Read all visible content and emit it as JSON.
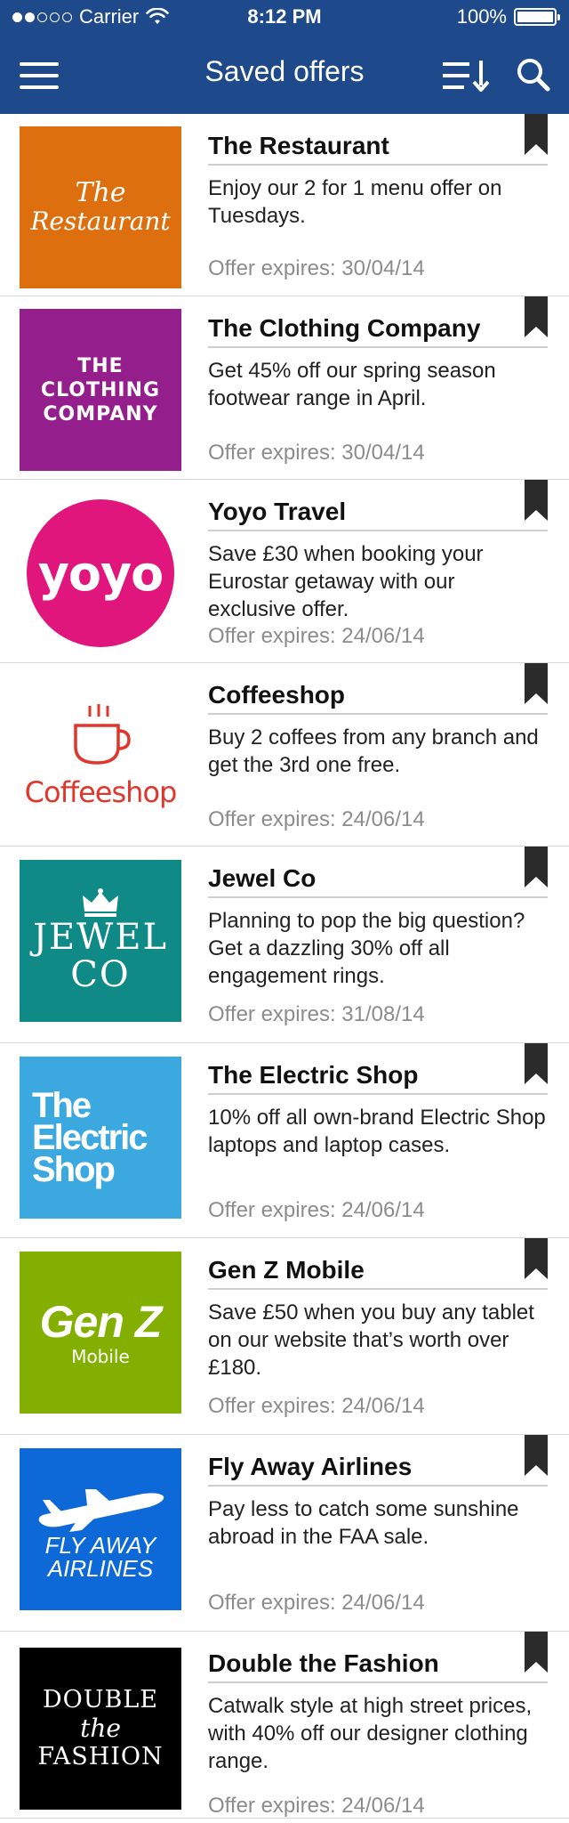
{
  "status_bar": {
    "carrier": "Carrier",
    "time": "8:12 PM",
    "battery": "100%"
  },
  "nav": {
    "title": "Saved offers",
    "icons": [
      "hamburger-menu-icon",
      "sort-icon",
      "search-icon"
    ]
  },
  "offers": [
    {
      "name": "The Restaurant",
      "description": "Enjoy our 2 for 1 menu offer on Tuesdays.",
      "expiry": "Offer expires: 30/04/14",
      "logo": {
        "style": "restaurant",
        "bg": "#dd6f0f",
        "lines": [
          "The",
          "Restaurant"
        ]
      }
    },
    {
      "name": "The Clothing Company",
      "description": "Get 45% off our spring season footwear range in April.",
      "expiry": "Offer expires: 30/04/14",
      "logo": {
        "style": "clothing",
        "bg": "#941f8c",
        "lines": [
          "THE",
          "CLOTHING",
          "COMPANY"
        ]
      }
    },
    {
      "name": "Yoyo Travel",
      "description": "Save £30 when booking your Eurostar getaway with our exclusive offer.",
      "expiry": "Offer expires: 24/06/14",
      "logo": {
        "style": "yoyo",
        "bg": "#e0167c",
        "lines": [
          "yoyo"
        ]
      }
    },
    {
      "name": "Coffeeshop",
      "description": "Buy 2 coffees from any branch and get the 3rd one free.",
      "expiry": "Offer expires: 24/06/14",
      "logo": {
        "style": "coffee",
        "bg": "#ffffff",
        "lines": [
          "Coffeeshop"
        ]
      }
    },
    {
      "name": "Jewel Co",
      "description": "Planning to pop the big question? Get a dazzling 30% off all engagement rings.",
      "expiry": "Offer expires: 31/08/14",
      "logo": {
        "style": "jewel",
        "bg": "#108a87",
        "lines": [
          "JEWEL",
          "CO"
        ]
      }
    },
    {
      "name": "The Electric Shop",
      "description": "10% off all own-brand Electric Shop laptops and laptop cases.",
      "expiry": "Offer expires: 24/06/14",
      "logo": {
        "style": "electric",
        "bg": "#3ba8e0",
        "lines": [
          "The",
          "Electric",
          "Shop"
        ]
      }
    },
    {
      "name": "Gen Z Mobile",
      "description": "Save £50 when you buy any tablet on our website that’s worth over £180.",
      "expiry": "Offer expires: 24/06/14",
      "logo": {
        "style": "genz",
        "bg": "#83b000",
        "lines": [
          "Gen Z",
          "Mobile"
        ]
      }
    },
    {
      "name": "Fly Away Airlines",
      "description": "Pay less to catch some sunshine abroad in the FAA sale.",
      "expiry": "Offer expires: 24/06/14",
      "logo": {
        "style": "fly",
        "bg": "#0d68d8",
        "lines": [
          "FLY AWAY",
          "AIRLINES"
        ]
      }
    },
    {
      "name": "Double the Fashion",
      "description": "Catwalk style at high street prices, with 40% off our designer clothing range.",
      "expiry": "Offer expires: 24/06/14",
      "logo": {
        "style": "fashion",
        "bg": "#000000",
        "lines": [
          "DOUBLE",
          "the",
          "FASHION"
        ]
      }
    }
  ],
  "colors": {
    "nav_bg": "#1e4a8c",
    "bookmark": "#2b2b2b",
    "expiry_text": "#8c8c8c",
    "divider": "#d8d8d8"
  }
}
